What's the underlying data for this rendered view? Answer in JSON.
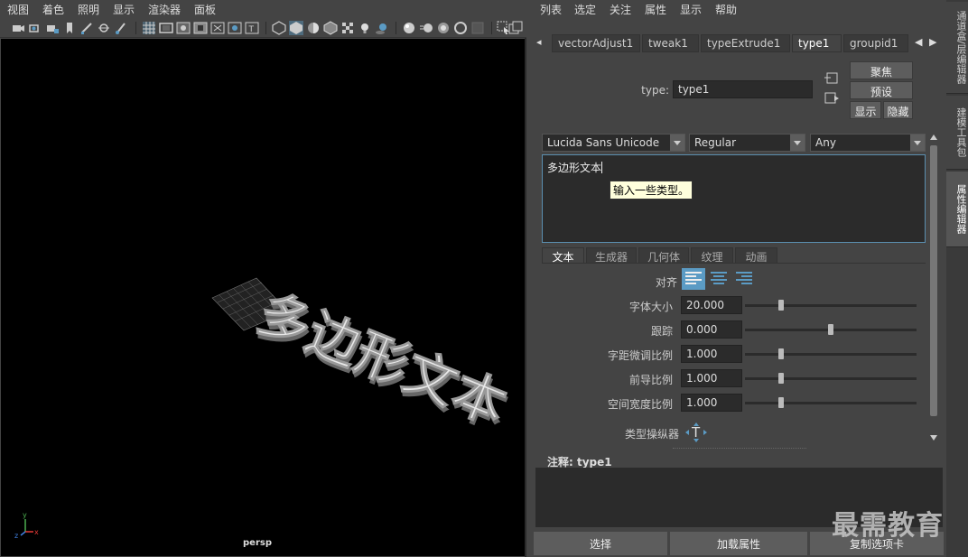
{
  "viewport": {
    "menus": [
      "视图",
      "着色",
      "照明",
      "显示",
      "渲染器",
      "面板"
    ],
    "camera_label": "persp",
    "scene_text": "多边形文本",
    "axis": {
      "x": "x",
      "y": "y",
      "z": "z"
    }
  },
  "attribute_editor": {
    "menus": [
      "列表",
      "选定",
      "关注",
      "属性",
      "显示",
      "帮助"
    ],
    "node_tabs": [
      "vectorAdjust1",
      "tweak1",
      "typeExtrude1",
      "type1",
      "groupid1"
    ],
    "active_tab": "type1",
    "type_label": "type:",
    "type_value": "type1",
    "buttons": {
      "focus": "聚焦",
      "presets": "预设",
      "show": "显示",
      "hide": "隐藏"
    },
    "font_family": "Lucida Sans Unicode",
    "font_style": "Regular",
    "writing_system": "Any",
    "text_content": "多边形文本",
    "tooltip": "输入一些类型。",
    "sub_tabs": [
      "文本",
      "生成器",
      "几何体",
      "纹理",
      "动画"
    ],
    "active_sub_tab": "文本",
    "align_label": "对齐",
    "fields": [
      {
        "label": "字体大小",
        "value": "20.000",
        "slider_pos": 0.21
      },
      {
        "label": "跟踪",
        "value": "0.000",
        "slider_pos": 0.5
      },
      {
        "label": "字距微调比例",
        "value": "1.000",
        "slider_pos": 0.21
      },
      {
        "label": "前导比例",
        "value": "1.000",
        "slider_pos": 0.21
      },
      {
        "label": "空间宽度比例",
        "value": "1.000",
        "slider_pos": 0.21
      }
    ],
    "manipulator_label": "类型操纵器",
    "notes_label": "注释:  type1",
    "bottom_buttons": [
      "选择",
      "加载属性",
      "复制选项卡"
    ],
    "watermark": "最需教育"
  },
  "side_tabs": [
    "通道盒/层编辑器",
    "建模工具包",
    "属性编辑器"
  ],
  "colors": {
    "accent": "#5b9bc4",
    "background": "#444444",
    "viewport_bg": "#000000"
  }
}
